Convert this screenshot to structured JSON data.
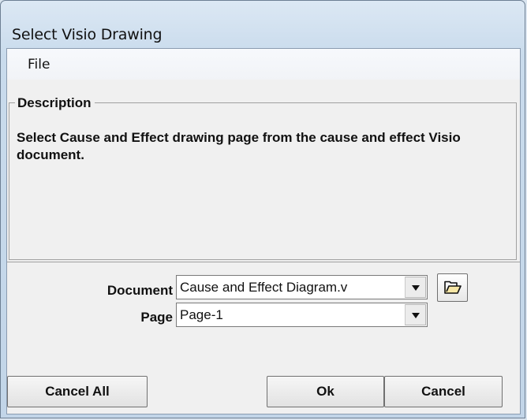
{
  "window": {
    "title": "Select Visio Drawing"
  },
  "menu": {
    "file_label": "File"
  },
  "description": {
    "group_title": "Description",
    "text": "Select Cause and Effect drawing page from the cause and effect Visio document."
  },
  "document_field": {
    "label": "Document",
    "value": "Cause and Effect Diagram.v"
  },
  "page_field": {
    "label": "Page",
    "value": "Page-1"
  },
  "buttons": {
    "cancel_all": "Cancel All",
    "ok": "Ok",
    "cancel": "Cancel"
  },
  "icons": {
    "browse": "folder-open-icon",
    "dropdown": "chevron-down-icon"
  }
}
